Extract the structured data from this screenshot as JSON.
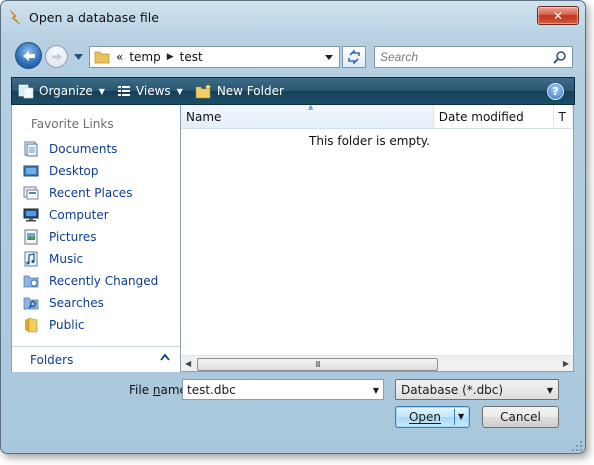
{
  "window": {
    "title": "Open a database file",
    "close_label": "✕"
  },
  "nav": {
    "breadcrumb_overflow": "«",
    "breadcrumbs": [
      "temp",
      "test"
    ],
    "search_placeholder": "Search"
  },
  "toolbar": {
    "organize_label": "Organize",
    "views_label": "Views",
    "new_folder_label": "New Folder",
    "help_label": "?"
  },
  "sidebar": {
    "heading": "Favorite Links",
    "items": [
      {
        "label": "Documents",
        "icon": "documents-icon"
      },
      {
        "label": "Desktop",
        "icon": "desktop-icon"
      },
      {
        "label": "Recent Places",
        "icon": "recent-places-icon"
      },
      {
        "label": "Computer",
        "icon": "computer-icon"
      },
      {
        "label": "Pictures",
        "icon": "pictures-icon"
      },
      {
        "label": "Music",
        "icon": "music-icon"
      },
      {
        "label": "Recently Changed",
        "icon": "recently-changed-icon"
      },
      {
        "label": "Searches",
        "icon": "searches-icon"
      },
      {
        "label": "Public",
        "icon": "public-folder-icon"
      }
    ],
    "folders_label": "Folders"
  },
  "filelist": {
    "columns": [
      "Name",
      "Date modified",
      "T"
    ],
    "empty_message": "This folder is empty.",
    "scroll_grip": "III"
  },
  "footer": {
    "filename_label_pre": "File ",
    "filename_label_accel": "n",
    "filename_label_post": "ame:",
    "filename_value": "test.dbc",
    "filetype_value": "Database (*.dbc)",
    "open_label": "Open",
    "cancel_label": "Cancel"
  },
  "colors": {
    "link_blue": "#0d3e8e",
    "toolbar_dark": "#1d4d68",
    "close_red": "#c1351f"
  }
}
